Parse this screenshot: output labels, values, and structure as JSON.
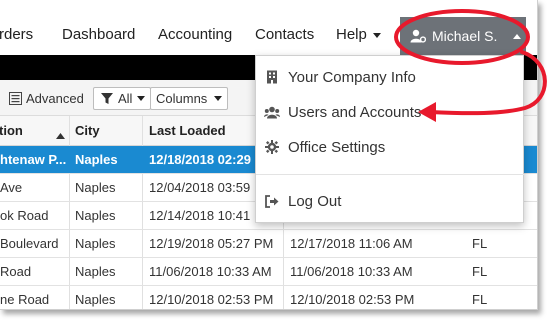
{
  "nav": {
    "items": [
      "rders",
      "Dashboard",
      "Accounting",
      "Contacts",
      "Help"
    ],
    "user_label": "Michael S."
  },
  "toolbar": {
    "advanced_label": "Advanced",
    "filter_label": "All",
    "columns_label": "Columns"
  },
  "grid": {
    "columns": [
      "tion",
      "City",
      "Last Loaded"
    ],
    "rows": [
      {
        "location": "htenaw P...",
        "city": "Naples",
        "last_loaded": "12/18/2018 02:29",
        "col4": "",
        "state": "",
        "selected": true
      },
      {
        "location": " Ave",
        "city": "Naples",
        "last_loaded": "12/04/2018 03:59",
        "col4": "",
        "state": ""
      },
      {
        "location": "ok Road",
        "city": "Naples",
        "last_loaded": "12/14/2018 10:41",
        "col4": "",
        "state": ""
      },
      {
        "location": " Boulevard",
        "city": "Naples",
        "last_loaded": "12/19/2018 05:27 PM",
        "col4": "12/17/2018 11:06 AM",
        "state": "FL"
      },
      {
        "location": "Road",
        "city": "Naples",
        "last_loaded": "11/06/2018 10:33 AM",
        "col4": "11/06/2018 10:33 AM",
        "state": "FL"
      },
      {
        "location": "ne Road",
        "city": "Naples",
        "last_loaded": "12/10/2018 02:53 PM",
        "col4": "12/10/2018 02:53 PM",
        "state": "FL"
      }
    ]
  },
  "menu": {
    "items": [
      {
        "label": "Your Company Info",
        "icon": "building-icon"
      },
      {
        "label": "Users and Accounts",
        "icon": "users-icon"
      },
      {
        "label": "Office Settings",
        "icon": "gear-icon"
      },
      {
        "label": "Log Out",
        "icon": "sign-out-icon"
      }
    ]
  },
  "colors": {
    "user_button": "#6d7278",
    "selected_row": "#1a8ad1",
    "annotation": "#e8192c"
  }
}
